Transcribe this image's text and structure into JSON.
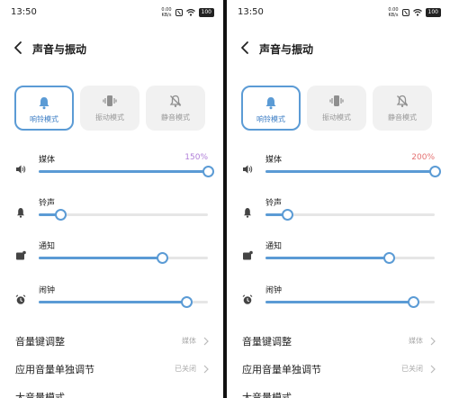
{
  "panels": [
    {
      "status": {
        "time": "13:50",
        "net_top": "0.00",
        "net_bottom": "KB/s",
        "battery": "100"
      },
      "header": {
        "title": "声音与振动"
      },
      "modes": [
        {
          "label": "响铃模式",
          "icon": "bell-icon",
          "active": true
        },
        {
          "label": "振动模式",
          "icon": "vibrate-icon",
          "active": false
        },
        {
          "label": "静音模式",
          "icon": "bell-off-icon",
          "active": false
        }
      ],
      "volumes": [
        {
          "label": "媒体",
          "value_text": "150%",
          "level": 1.0,
          "icon": "speaker-icon"
        },
        {
          "label": "铃声",
          "value_text": "",
          "level": 0.13,
          "icon": "bell-icon"
        },
        {
          "label": "通知",
          "value_text": "",
          "level": 0.73,
          "icon": "notification-icon"
        },
        {
          "label": "闹钟",
          "value_text": "",
          "level": 0.87,
          "icon": "alarm-icon"
        }
      ],
      "settings": [
        {
          "label": "音量键调整",
          "value": "媒体"
        },
        {
          "label": "应用音量单独调节",
          "value": "已关闭"
        },
        {
          "label": "大音量模式",
          "value": ""
        }
      ]
    },
    {
      "status": {
        "time": "13:50",
        "net_top": "0.00",
        "net_bottom": "KB/s",
        "battery": "100"
      },
      "header": {
        "title": "声音与振动"
      },
      "modes": [
        {
          "label": "响铃模式",
          "icon": "bell-icon",
          "active": true
        },
        {
          "label": "振动模式",
          "icon": "vibrate-icon",
          "active": false
        },
        {
          "label": "静音模式",
          "icon": "bell-off-icon",
          "active": false
        }
      ],
      "volumes": [
        {
          "label": "媒体",
          "value_text": "200%",
          "level": 1.0,
          "icon": "speaker-icon"
        },
        {
          "label": "铃声",
          "value_text": "",
          "level": 0.13,
          "icon": "bell-icon"
        },
        {
          "label": "通知",
          "value_text": "",
          "level": 0.73,
          "icon": "notification-icon"
        },
        {
          "label": "闹钟",
          "value_text": "",
          "level": 0.87,
          "icon": "alarm-icon"
        }
      ],
      "settings": [
        {
          "label": "音量键调整",
          "value": "媒体"
        },
        {
          "label": "应用音量单独调节",
          "value": "已关闭"
        },
        {
          "label": "大音量模式",
          "value": ""
        }
      ]
    }
  ],
  "colors": {
    "accent": "#5b9bd5",
    "media_value_left": "#b07fd8",
    "media_value_right": "#e57373",
    "inactive_card": "#f1f1f1",
    "muted_text": "#aaaaaa"
  }
}
